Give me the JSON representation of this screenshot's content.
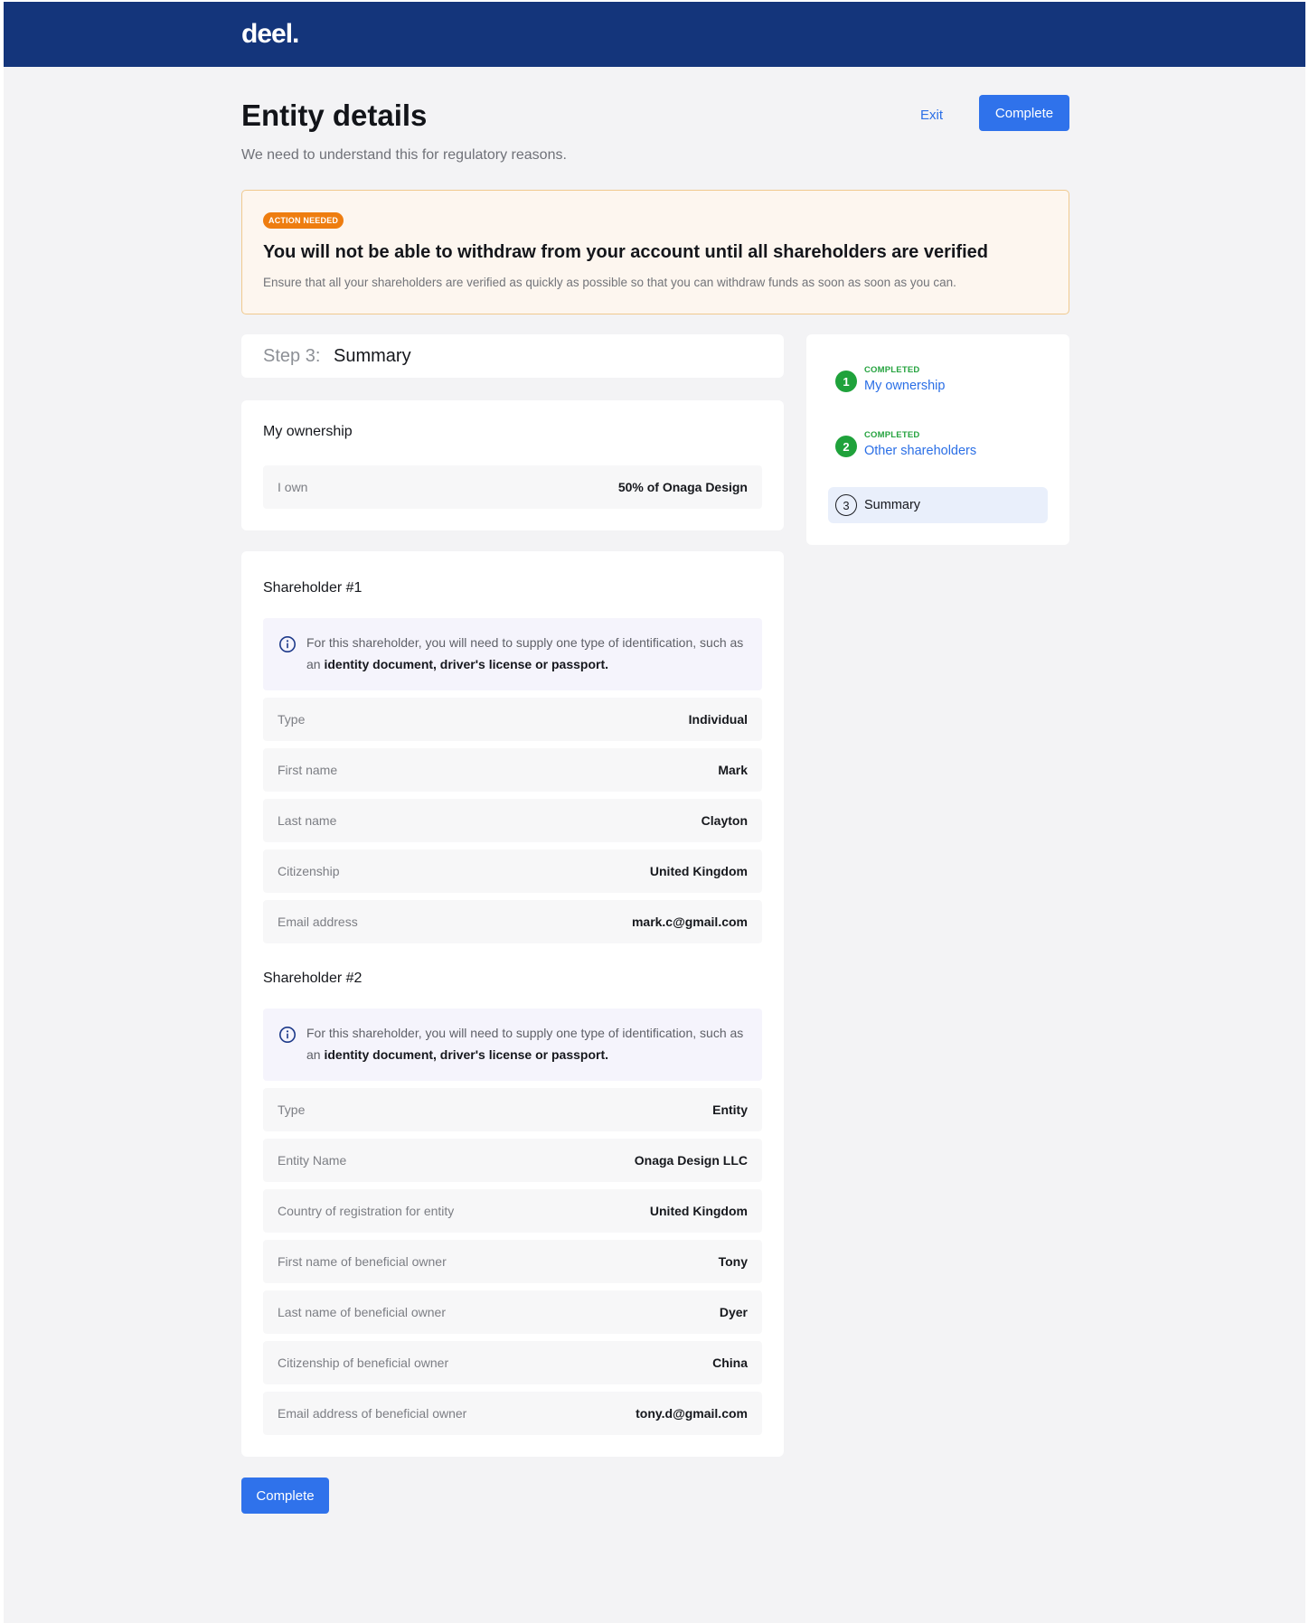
{
  "header": {
    "logo": "deel."
  },
  "page": {
    "title": "Entity details",
    "subtitle": "We need to understand this for regulatory reasons.",
    "exit_label": "Exit",
    "complete_label": "Complete"
  },
  "alert": {
    "badge": "ACTION NEEDED",
    "title": "You will not be able to withdraw from your account until all shareholders are verified",
    "body": "Ensure that all your shareholders are verified as quickly as possible so that you can withdraw funds as soon as soon as you can."
  },
  "step": {
    "prefix": "Step 3:",
    "name": "Summary"
  },
  "ownership": {
    "title": "My ownership",
    "label": "I own",
    "value": "50% of Onaga Design"
  },
  "info": {
    "text_before": "For this shareholder, you will need to supply one type of identification, such as an ",
    "text_bold": "identity document, driver's license or passport."
  },
  "shareholders": [
    {
      "title": "Shareholder #1",
      "rows": [
        {
          "label": "Type",
          "value": "Individual"
        },
        {
          "label": "First name",
          "value": "Mark"
        },
        {
          "label": "Last name",
          "value": "Clayton"
        },
        {
          "label": "Citizenship",
          "value": "United Kingdom"
        },
        {
          "label": "Email address",
          "value": "mark.c@gmail.com"
        }
      ]
    },
    {
      "title": "Shareholder #2",
      "rows": [
        {
          "label": "Type",
          "value": "Entity"
        },
        {
          "label": "Entity Name",
          "value": "Onaga Design LLC"
        },
        {
          "label": "Country of registration for entity",
          "value": "United Kingdom"
        },
        {
          "label": "First name of beneficial owner",
          "value": "Tony"
        },
        {
          "label": "Last name of beneficial owner",
          "value": "Dyer"
        },
        {
          "label": "Citizenship of beneficial owner",
          "value": "China"
        },
        {
          "label": "Email address of beneficial owner",
          "value": "tony.d@gmail.com"
        }
      ]
    }
  ],
  "stepper": {
    "items": [
      {
        "number": "1",
        "status": "COMPLETED",
        "label": "My ownership"
      },
      {
        "number": "2",
        "status": "COMPLETED",
        "label": "Other shareholders"
      },
      {
        "number": "3",
        "status": "",
        "label": "Summary"
      }
    ]
  },
  "colors": {
    "topbar": "#14357b",
    "primary": "#2f72eb",
    "badge": "#ee7d10",
    "completed": "#1fa23b",
    "alert_bg": "#fdf6ef"
  }
}
